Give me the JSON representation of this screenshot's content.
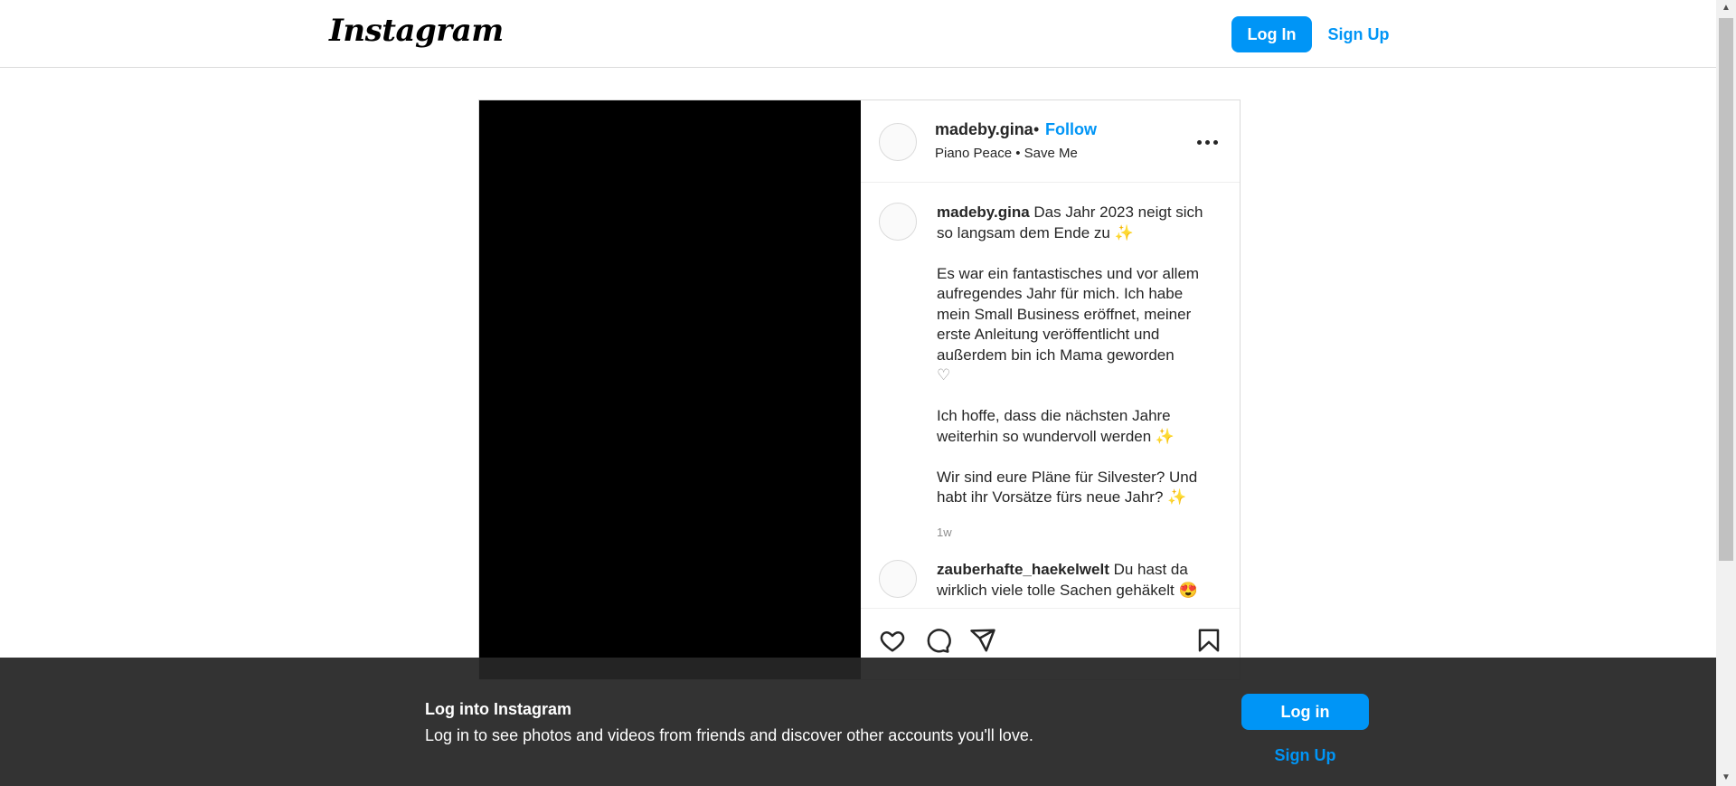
{
  "nav": {
    "logo": "Instagram",
    "login_label": "Log In",
    "signup_label": "Sign Up"
  },
  "post": {
    "author": "madeby.gina",
    "separator": "•",
    "follow_label": "Follow",
    "audio": "Piano Peace • Save Me",
    "caption": {
      "username": "madeby.gina",
      "line1": "Das Jahr 2023 neigt sich so langsam dem Ende zu",
      "line2": "Es war ein fantastisches und vor allem aufregendes Jahr für mich. Ich habe mein Small Business eröffnet, meiner erste Anleitung veröffentlicht und außerdem bin ich Mama geworden",
      "line3": "Ich hoffe, dass die nächsten Jahre weiterhin so wundervoll werden",
      "line4": "Wir sind eure Pläne für Silvester? Und habt ihr Vorsätze fürs neue Jahr?",
      "sparkle": "✨",
      "heart": "♡",
      "time": "1w"
    },
    "comment": {
      "username": "zauberhafte_haekelwelt",
      "text": "Du hast da wirklich viele tolle Sachen gehäkelt",
      "emoji": "😍"
    }
  },
  "banner": {
    "title": "Log into Instagram",
    "subtitle": "Log in to see photos and videos from friends and discover other accounts you'll love.",
    "login_label": "Log in",
    "signup_label": "Sign Up"
  },
  "icons": {
    "like": "heart-icon",
    "comment": "comment-icon",
    "share": "share-icon",
    "save": "bookmark-icon",
    "more": "more-icon"
  },
  "colors": {
    "accent": "#0095f6",
    "banner_bg": "#262626",
    "border": "#dbdbdb"
  }
}
